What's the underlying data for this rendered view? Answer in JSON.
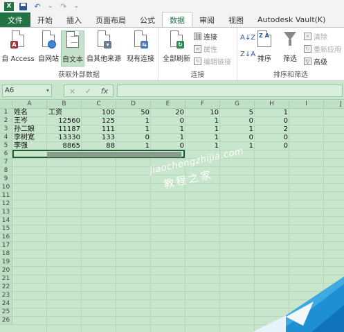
{
  "qat": {
    "undo_glyph": "↶",
    "redo_glyph": "↷",
    "sep": "⌄"
  },
  "tabs": [
    "文件",
    "开始",
    "插入",
    "页面布局",
    "公式",
    "数据",
    "审阅",
    "视图",
    "Autodesk Vault(K)"
  ],
  "ribbon": {
    "get_external": {
      "label": "获取外部数据",
      "from_access": "自 Access",
      "from_web": "自网站",
      "from_text": "自文本",
      "from_other": "自其他来源",
      "existing": "现有连接"
    },
    "connections": {
      "label": "连接",
      "refresh_all": "全部刷新",
      "connections": "连接",
      "properties": "属性",
      "edit_links": "编辑链接"
    },
    "sort_filter": {
      "label": "排序和筛选",
      "sort": "排序",
      "filter": "筛选",
      "clear": "清除",
      "reapply": "重新应用",
      "advanced": "高级"
    }
  },
  "formula_bar": {
    "name_box": "A6",
    "cancel": "×",
    "enter": "✓",
    "fx": "fx"
  },
  "columns": [
    "A",
    "B",
    "C",
    "D",
    "E",
    "F",
    "G",
    "H",
    "I",
    "J"
  ],
  "rows": [
    "1",
    "2",
    "3",
    "4",
    "5",
    "6",
    "7",
    "8",
    "9",
    "10",
    "11",
    "12",
    "13",
    "14",
    "15",
    "16",
    "17",
    "18",
    "19",
    "20",
    "21",
    "22",
    "23",
    "24",
    "25",
    "26"
  ],
  "data": [
    [
      "姓名",
      "工资",
      "100",
      "50",
      "20",
      "10",
      "5",
      "1"
    ],
    [
      "王岑",
      "12560",
      "125",
      "1",
      "0",
      "1",
      "0",
      "0"
    ],
    [
      "孙二娘",
      "11187",
      "111",
      "1",
      "1",
      "1",
      "1",
      "2"
    ],
    [
      "李树宽",
      "13330",
      "133",
      "0",
      "1",
      "1",
      "0",
      "0"
    ],
    [
      "李强",
      "8865",
      "88",
      "1",
      "0",
      "1",
      "1",
      "0"
    ]
  ],
  "watermark": {
    "line1": "jiaochengzhijia.com",
    "line2": "教程之家"
  },
  "colors": {
    "excel_green": "#217346",
    "sheet_bg": "#c7e6cc",
    "grid": "#b4d6ba"
  }
}
